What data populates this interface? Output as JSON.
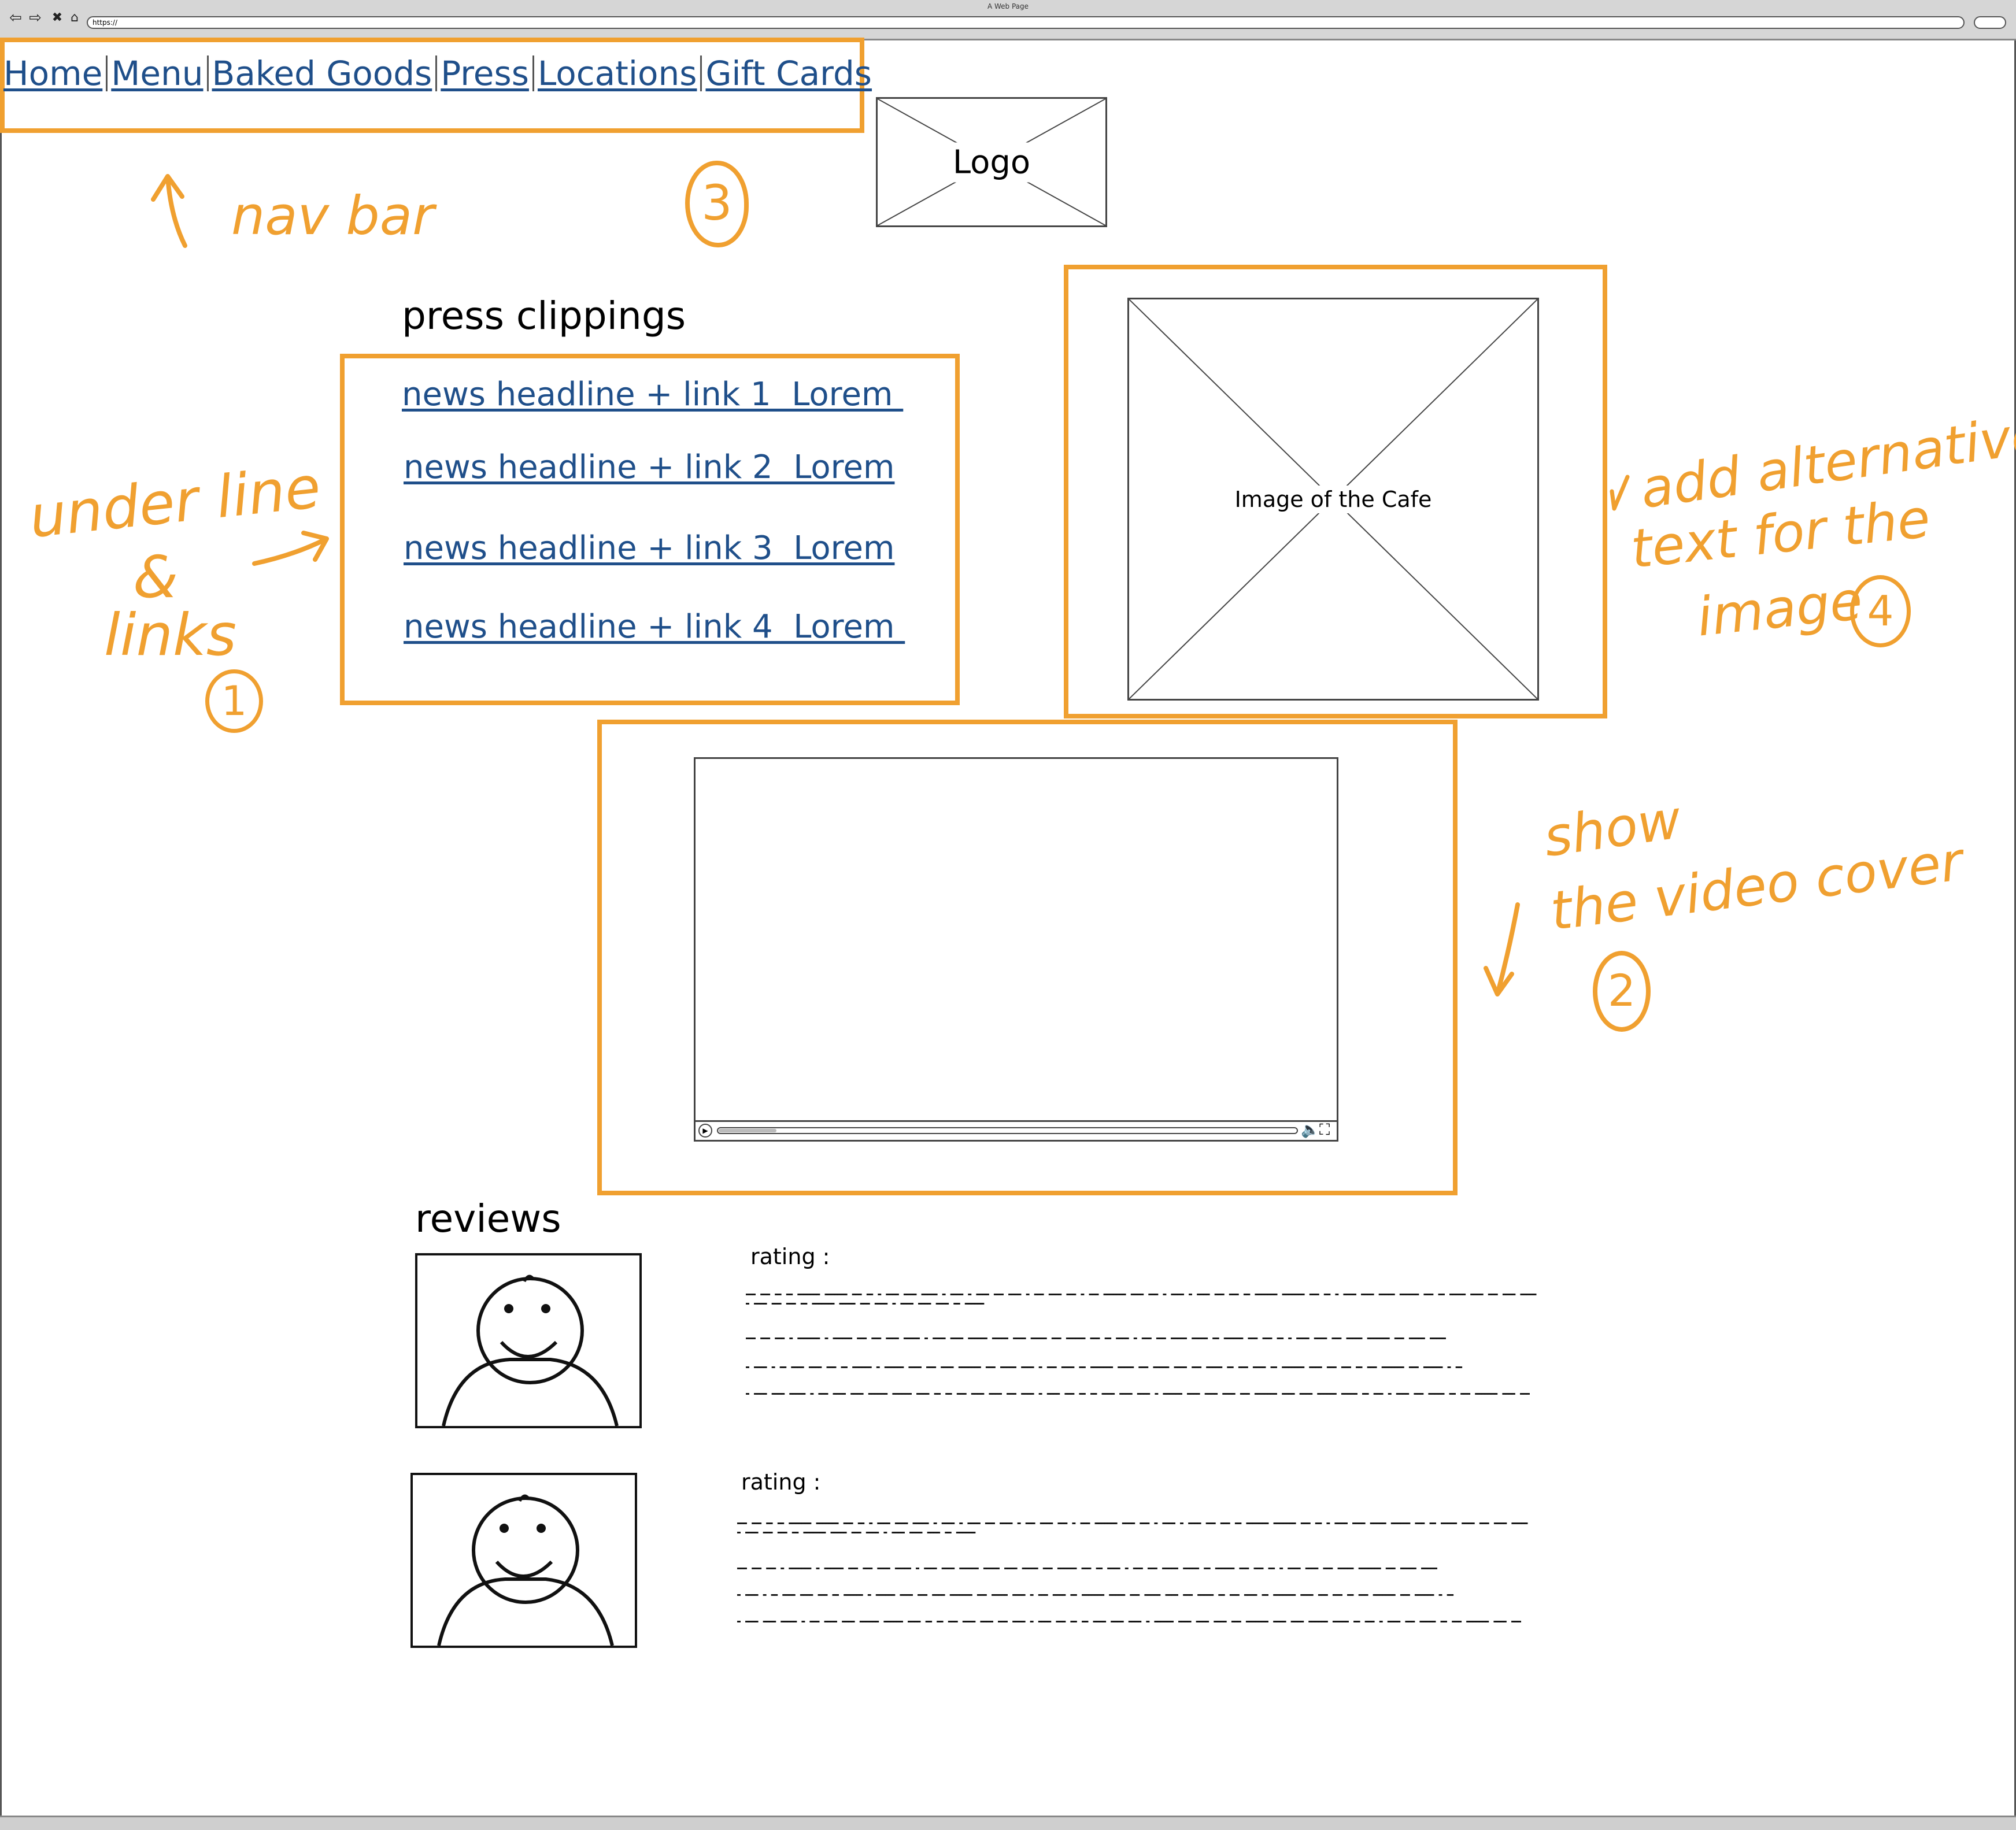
{
  "browser": {
    "window_title": "A Web Page",
    "url": "https://"
  },
  "nav": {
    "items": [
      "Home",
      "Menu",
      "Baked Goods",
      "Press",
      "Locations",
      "Gift Cards"
    ]
  },
  "logo": {
    "label": "Logo"
  },
  "press": {
    "heading": "press clippings",
    "links": [
      "news headline + link 1  Lorem ",
      "news headline + link 2  Lorem",
      "news headline + link 3  Lorem",
      "news headline + link 4  Lorem "
    ]
  },
  "cafe_image": {
    "label": "Image of the Cafe"
  },
  "reviews": {
    "heading": "reviews",
    "items": [
      {
        "rating_label": "rating :"
      },
      {
        "rating_label": "rating :"
      }
    ]
  },
  "annotations": {
    "nav_bar": "nav bar",
    "num_3": "3",
    "underline_1": "under line",
    "underline_2": "&",
    "underline_3": "links",
    "num_1": "1",
    "alt_1": "add alternative",
    "alt_2": "text for the",
    "alt_3": "image",
    "num_4": "4",
    "video_1": "show",
    "video_2": "the video cover",
    "num_2": "2"
  },
  "colors": {
    "annotation_orange": "#f0a030",
    "link_blue": "#1f4f8a"
  },
  "icons": [
    "back-arrow-icon",
    "forward-arrow-icon",
    "close-x-icon",
    "home-icon",
    "play-icon",
    "volume-icon",
    "fullscreen-icon",
    "smiley-person-icon"
  ]
}
